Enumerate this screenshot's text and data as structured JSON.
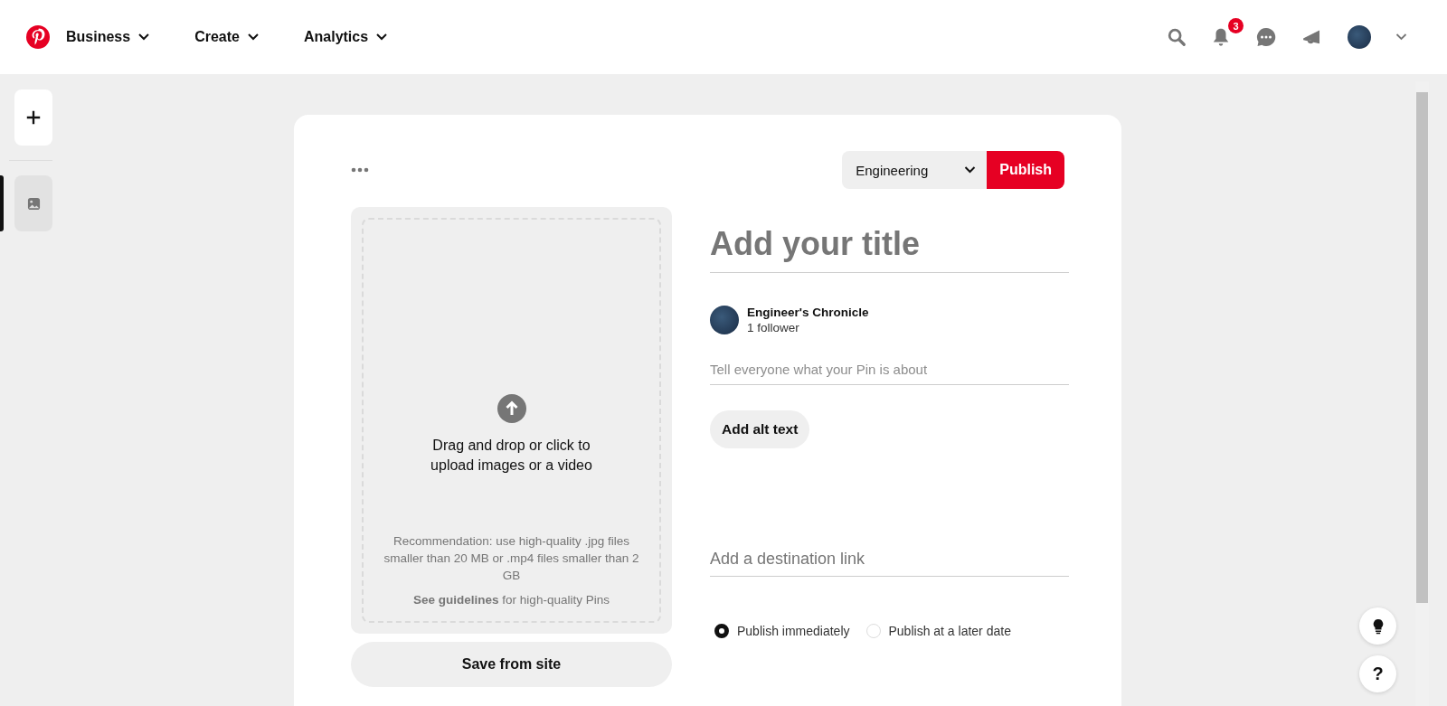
{
  "nav": [
    {
      "label": "Business"
    },
    {
      "label": "Create"
    },
    {
      "label": "Analytics"
    }
  ],
  "notifications": {
    "count": "3"
  },
  "sidebar": {
    "items": [
      {
        "kind": "add",
        "selected": false
      },
      {
        "kind": "image",
        "selected": true
      }
    ]
  },
  "board_select": {
    "value": "Engineering"
  },
  "publish_button": "Publish",
  "upload": {
    "prompt": "Drag and drop or click to upload images or a video",
    "recommendation": "Recommendation: use high-quality .jpg files smaller than 20 MB or .mp4 files smaller than 2 GB",
    "guidelines_link": "See guidelines",
    "guidelines_rest": "for high-quality Pins"
  },
  "save_from_site": "Save from site",
  "title": {
    "placeholder": "Add your title"
  },
  "account": {
    "name": "Engineer's Chronicle",
    "followers": "1 follower"
  },
  "description": {
    "placeholder": "Tell everyone what your Pin is about"
  },
  "alt_text_button": "Add alt text",
  "link": {
    "placeholder": "Add a destination link"
  },
  "publish_options": [
    {
      "label": "Publish immediately",
      "selected": true
    },
    {
      "label": "Publish at a later date",
      "selected": false
    }
  ],
  "help_button": "?"
}
